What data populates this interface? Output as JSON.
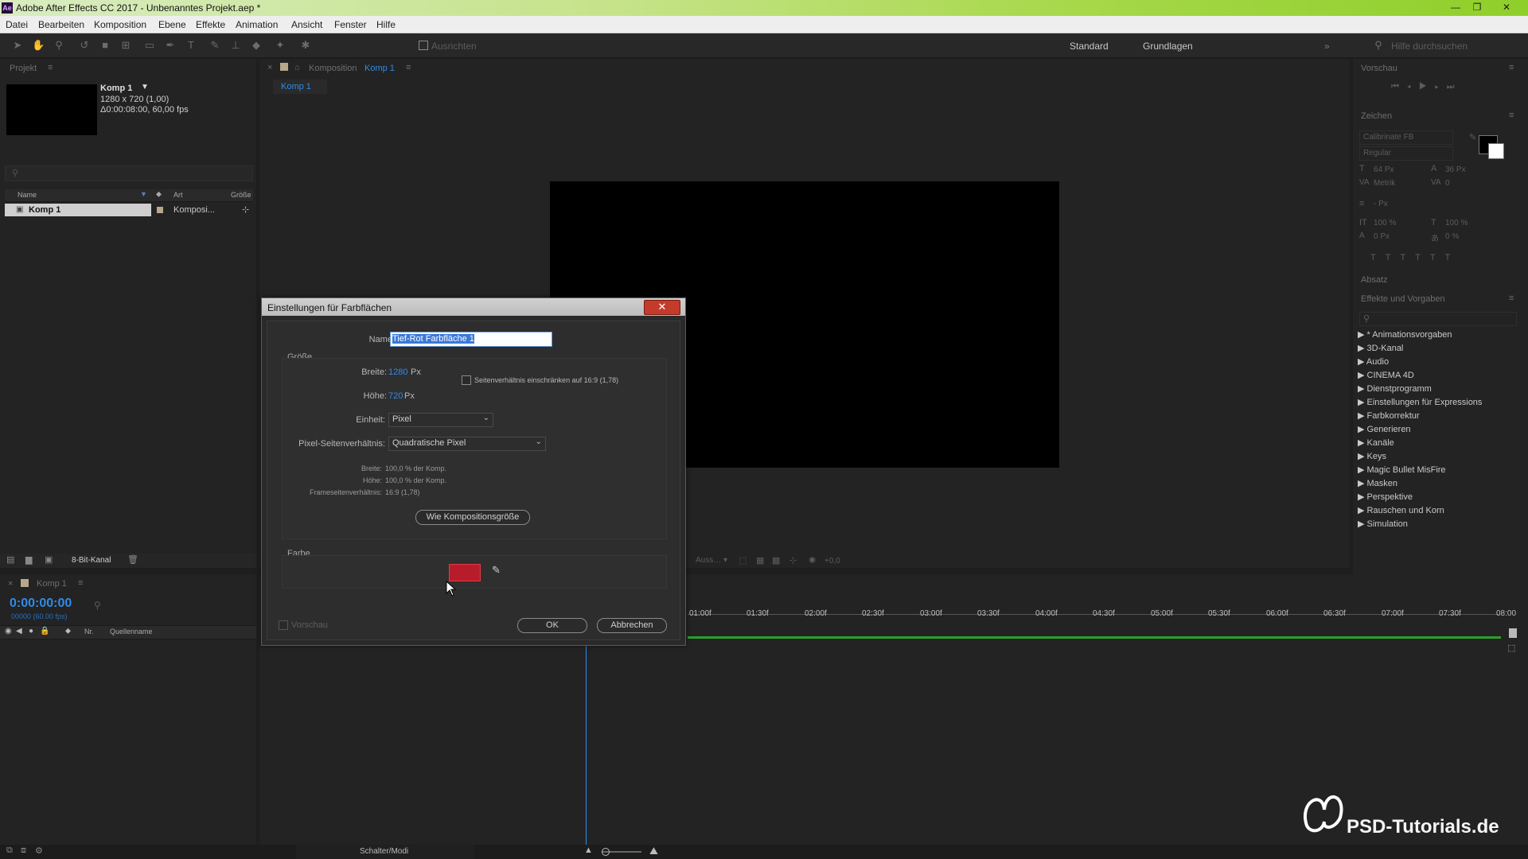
{
  "window": {
    "title": "Adobe After Effects CC 2017 - Unbenanntes Projekt.aep *",
    "app_icon": "Ae",
    "minimize_icon": "—",
    "maximize_icon": "❐",
    "close_icon": "✕"
  },
  "menu": [
    "Datei",
    "Bearbeiten",
    "Komposition",
    "Ebene",
    "Effekte",
    "Animation",
    "Ansicht",
    "Fenster",
    "Hilfe"
  ],
  "toolbar": {
    "align_label": "Ausrichten",
    "workspace_standard": "Standard",
    "workspace_basics": "Grundlagen",
    "help_search": "Hilfe durchsuchen"
  },
  "project": {
    "header": "Projekt",
    "comp_name": "Komp 1",
    "comp_size": "1280 x 720 (1,00)",
    "comp_duration": "Δ0:00:08:00, 60,00 fps",
    "columns": {
      "name": "Name",
      "type": "Art",
      "size": "Größe"
    },
    "item_name": "Komp 1",
    "item_type": "Komposi...",
    "bit_depth": "8-Bit-Kanal"
  },
  "composition": {
    "header_prefix": "Komposition",
    "header_name": "Komp 1",
    "tab": "Komp 1",
    "exposure_value": "+0,0"
  },
  "right_panel": {
    "preview": "Vorschau",
    "character": "Zeichen",
    "font": "Calibrinate FB",
    "style": "Regular",
    "size": "64 Px",
    "leading": "36 Px",
    "tracking_mode": "Metrik",
    "tracking_value": "0",
    "stroke": "- Px",
    "scale_v": "100 %",
    "scale_h": "100 %",
    "baseline": "0 Px",
    "tsume": "0 %",
    "paragraph": "Absatz",
    "effects_header": "Effekte und Vorgaben",
    "effects": [
      "* Animationsvorgaben",
      "3D-Kanal",
      "Audio",
      "CINEMA 4D",
      "Dienstprogramm",
      "Einstellungen für Expressions",
      "Farbkorrektur",
      "Generieren",
      "Kanäle",
      "Keys",
      "Magic Bullet MisFire",
      "Masken",
      "Perspektive",
      "Rauschen und Korn",
      "Simulation"
    ]
  },
  "timeline": {
    "comp_tab": "Komp 1",
    "timecode": "0:00:00:00",
    "frames": "00000 (60.00 fps)",
    "col_nr": "Nr.",
    "col_source": "Quellenname",
    "ruler": [
      "01:00f",
      "01:30f",
      "02:00f",
      "02:30f",
      "03:00f",
      "03:30f",
      "04:00f",
      "04:30f",
      "05:00f",
      "05:30f",
      "06:00f",
      "06:30f",
      "07:00f",
      "07:30f",
      "08:00"
    ],
    "switches_modes": "Schalter/Modi"
  },
  "dialog": {
    "title": "Einstellungen für Farbflächen",
    "close_label": "✕",
    "name_label": "Name:",
    "name_value": "Tief-Rot Farbfläche 1",
    "size_group": "Größe",
    "width_label": "Breite:",
    "width_value": "1280",
    "width_unit": "Px",
    "height_label": "Höhe:",
    "height_value": "720",
    "height_unit": "Px",
    "lock_aspect": "Seitenverhältnis einschränken auf 16:9 (1,78)",
    "unit_label": "Einheit:",
    "unit_value": "Pixel",
    "par_label": "Pixel-Seitenverhältnis:",
    "par_value": "Quadratische Pixel",
    "info_width_label": "Breite:",
    "info_width_value": "100,0 % der Komp.",
    "info_height_label": "Höhe:",
    "info_height_value": "100,0 % der Komp.",
    "info_frame_label": "Frameseitenverhältnis:",
    "info_frame_value": "16:9 (1,78)",
    "comp_size_button": "Wie Kompositionsgröße",
    "color_group": "Farbe",
    "color_value": "#b81c2a",
    "preview_label": "Vorschau",
    "ok": "OK",
    "cancel": "Abbrechen"
  },
  "watermark": "PSD-Tutorials.de"
}
